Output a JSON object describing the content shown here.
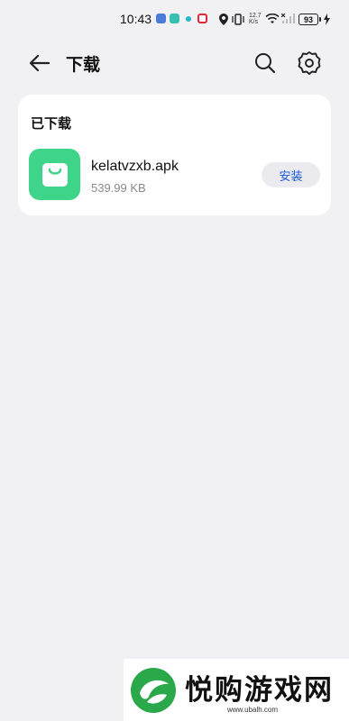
{
  "status_bar": {
    "time": "10:43",
    "net_speed_value": "12.7",
    "net_speed_unit": "K/s",
    "battery": "93"
  },
  "toolbar": {
    "title": "下载"
  },
  "downloads": {
    "section_title": "已下载",
    "items": [
      {
        "name": "kelatvzxb.apk",
        "size": "539.99 KB",
        "action_label": "安装",
        "icon": "shopping-bag-icon"
      }
    ]
  },
  "watermark": {
    "brand": "悦购游戏网",
    "url": "www.ubalh.com"
  },
  "colors": {
    "background": "#f1f1f3",
    "card": "#ffffff",
    "accent_blue": "#1a56db",
    "apk_icon_green": "#3ed58a",
    "watermark_green": "#2aa84a"
  }
}
